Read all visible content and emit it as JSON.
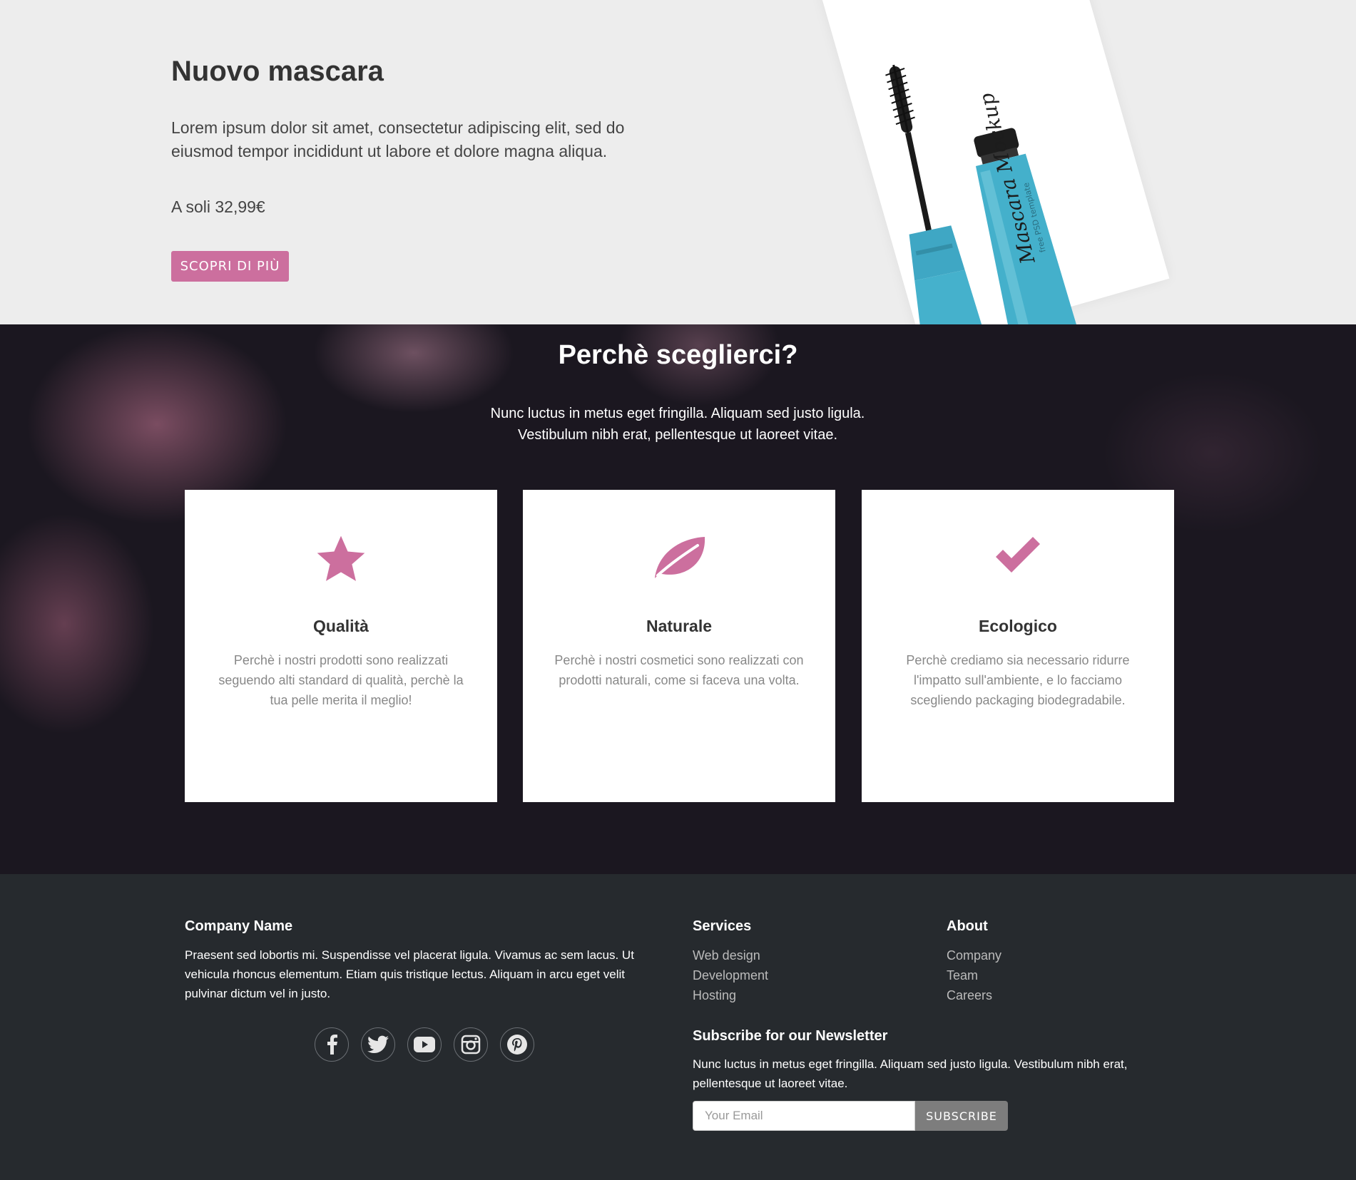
{
  "hero": {
    "title": "Nuovo mascara",
    "text": "Lorem ipsum dolor sit amet, consectetur adipiscing elit, sed do eiusmod tempor incididunt ut labore et dolore magna aliqua.",
    "price": "A soli 32,99€",
    "button": "SCOPRI DI PIÙ",
    "product_label": "Mascara Mockup",
    "product_sublabel": "free PSD template"
  },
  "why": {
    "title": "Perchè sceglierci?",
    "subtitle": "Nunc luctus in metus eget fringilla. Aliquam sed justo ligula. Vestibulum nibh erat, pellentesque ut laoreet vitae.",
    "features": [
      {
        "icon": "star-icon",
        "title": "Qualità",
        "text": "Perchè i nostri prodotti sono realizzati seguendo alti standard di qualità, perchè la tua pelle merita il meglio!"
      },
      {
        "icon": "leaf-icon",
        "title": "Naturale",
        "text": "Perchè i nostri cosmetici sono realizzati con prodotti naturali, come si faceva una volta."
      },
      {
        "icon": "check-icon",
        "title": "Ecologico",
        "text": "Perchè crediamo sia necessario ridurre l'impatto sull'ambiente, e lo facciamo scegliendo packaging biodegradabile."
      }
    ]
  },
  "footer": {
    "company": {
      "name": "Company Name",
      "text": "Praesent sed lobortis mi. Suspendisse vel placerat ligula. Vivamus ac sem lacus. Ut vehicula rhoncus elementum. Etiam quis tristique lectus. Aliquam in arcu eget velit pulvinar dictum vel in justo."
    },
    "social": [
      "facebook-icon",
      "twitter-icon",
      "youtube-icon",
      "instagram-icon",
      "pinterest-icon"
    ],
    "services": {
      "title": "Services",
      "items": [
        "Web design",
        "Development",
        "Hosting"
      ]
    },
    "about": {
      "title": "About",
      "items": [
        "Company",
        "Team",
        "Careers"
      ]
    },
    "newsletter": {
      "title": "Subscribe for our Newsletter",
      "text": "Nunc luctus in metus eget fringilla. Aliquam sed justo ligula. Vestibulum nibh erat, pellentesque ut laoreet vitae.",
      "placeholder": "Your Email",
      "button": "SUBSCRIBE"
    }
  },
  "colors": {
    "accent": "#cc6f9e",
    "footer_bg": "#262a2e",
    "mascara_blue": "#3fa7c4"
  }
}
